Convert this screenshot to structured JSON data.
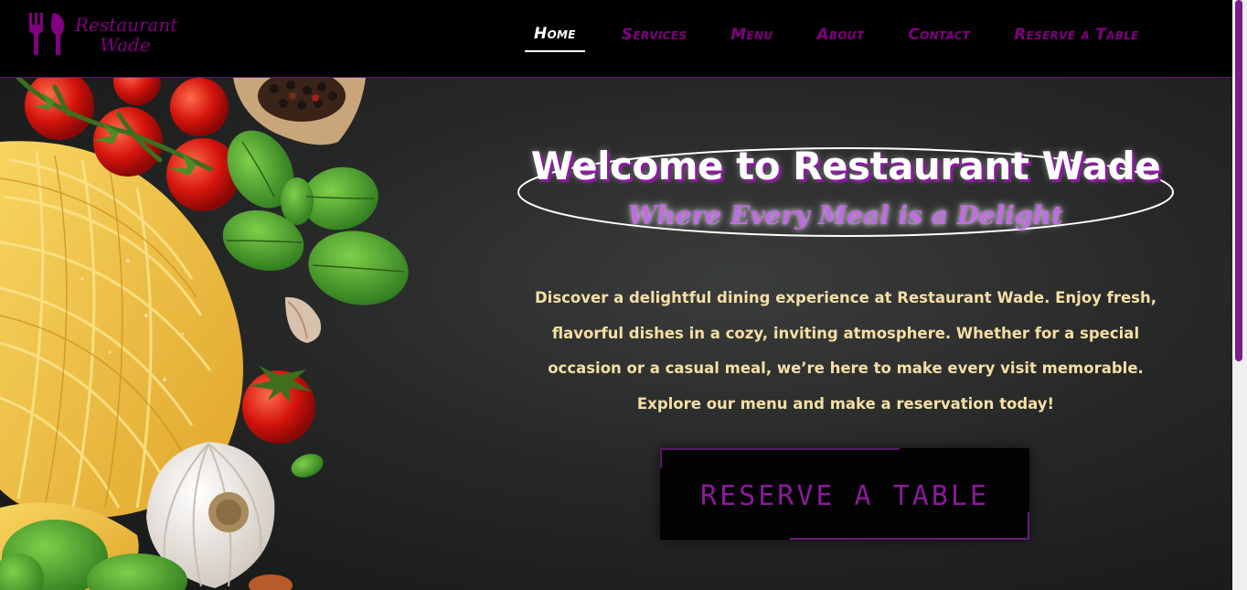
{
  "logo": {
    "line1": "Restaurant",
    "line2": "Wade",
    "icon": "fork-knife-icon"
  },
  "nav": {
    "items": [
      {
        "label": "Home",
        "active": true
      },
      {
        "label": "Services",
        "active": false
      },
      {
        "label": "Menu",
        "active": false
      },
      {
        "label": "About",
        "active": false
      },
      {
        "label": "Contact",
        "active": false
      },
      {
        "label": "Reserve a Table",
        "active": false
      }
    ]
  },
  "hero": {
    "title": "Welcome to Restaurant Wade",
    "subtitle": "Where Every Meal is a Delight",
    "description": "Discover a delightful dining experience at Restaurant Wade. Enjoy fresh, flavorful dishes in a cozy, inviting atmosphere. Whether for a special occasion or a casual meal, we’re here to make every visit memorable. Explore our menu and make a reservation today!",
    "cta_label": "RESERVE A TABLE"
  },
  "colors": {
    "accent": "#800080",
    "cream": "#f6dfa5",
    "subtitle": "#c26be6"
  }
}
